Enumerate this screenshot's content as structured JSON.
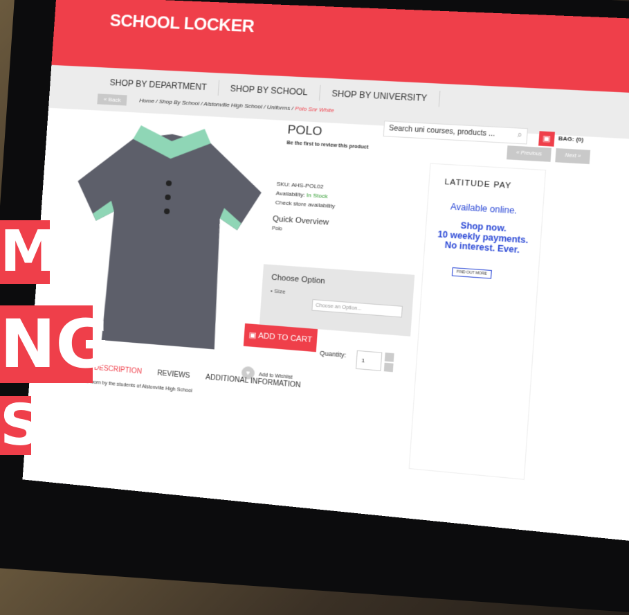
{
  "header": {
    "logo": "SCHOOL LOCKER",
    "search_placeholder": "Search uni courses, products ...",
    "bag": "BAG: (0)"
  },
  "nav": {
    "items": [
      "SHOP BY DEPARTMENT",
      "SHOP BY SCHOOL",
      "SHOP BY UNIVERSITY"
    ],
    "back": "« Back"
  },
  "breadcrumb": {
    "home": "Home",
    "shop_by_school": "Shop By School",
    "school": "Alstonville High School",
    "uniforms": "Uniforms",
    "current": "Polo Snr White"
  },
  "product": {
    "title": "POLO",
    "review_prompt": "Be the first to review this product",
    "sku": "SKU: AHS-POL02",
    "availability_label": "Availability:",
    "availability_value": "In Stock",
    "store_check": "Check store availability",
    "quick_overview_title": "Quick Overview",
    "quick_overview_text": "Polo"
  },
  "options": {
    "title": "Choose Option",
    "size_label": "• Size",
    "size_placeholder": "Choose an Option..."
  },
  "cart": {
    "add_label": "ADD TO CART",
    "quantity_label": "Quantity:",
    "quantity_value": "1",
    "wishlist": "Add to Wishlist"
  },
  "pager": {
    "prev": "« Previous",
    "next": "Next »"
  },
  "tabs": {
    "description": "PRODUCT DESCRIPTION",
    "reviews": "REVIEWS",
    "additional": "ADDITIONAL INFORMATION"
  },
  "description": "Senior White Polo worn by the students of Alstonville High School",
  "ad": {
    "brand": "LATITUDE PAY",
    "line1": "Available online.",
    "line2": "Shop now.",
    "line3": "10 weekly payments.",
    "line4": "No interest. Ever.",
    "cta": "FIND OUT MORE"
  },
  "overlay": {
    "line1": "M",
    "line2": "NG",
    "line3": "S"
  },
  "colors": {
    "brand": "#ef3f4a",
    "accent": "#2d4ad6",
    "stock": "#2e9a2e"
  }
}
